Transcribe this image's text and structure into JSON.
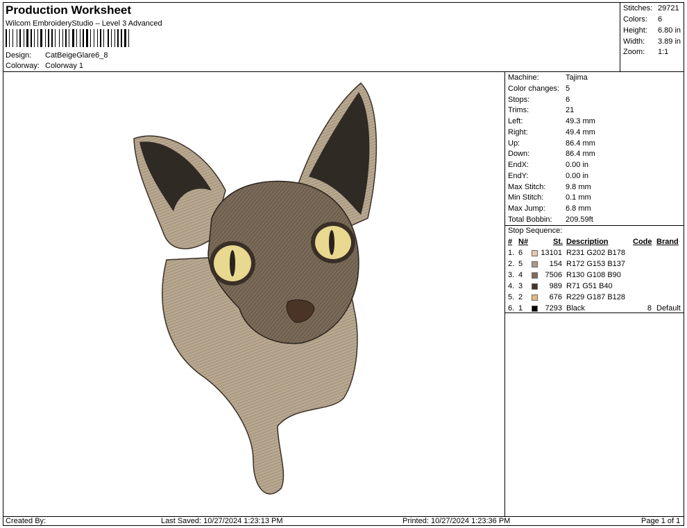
{
  "header": {
    "title": "Production Worksheet",
    "subtitle": "Wilcom EmbroideryStudio – Level 3 Advanced",
    "design_label": "Design:",
    "design_value": "CatBeigeGlare6_8",
    "colorway_label": "Colorway:",
    "colorway_value": "Colorway 1"
  },
  "stats": [
    {
      "k": "Stitches:",
      "v": "29721"
    },
    {
      "k": "Colors:",
      "v": "6"
    },
    {
      "k": "Height:",
      "v": "6.80 in"
    },
    {
      "k": "Width:",
      "v": "3.89 in"
    },
    {
      "k": "Zoom:",
      "v": "1:1"
    }
  ],
  "machine_info": [
    {
      "k": "Machine:",
      "v": "Tajima"
    },
    {
      "k": "Color changes:",
      "v": "5"
    },
    {
      "k": "Stops:",
      "v": "6"
    },
    {
      "k": "Trims:",
      "v": "21"
    },
    {
      "k": "Left:",
      "v": "49.3 mm"
    },
    {
      "k": "Right:",
      "v": "49.4 mm"
    },
    {
      "k": "Up:",
      "v": "86.4 mm"
    },
    {
      "k": "Down:",
      "v": "86.4 mm"
    },
    {
      "k": "EndX:",
      "v": "0.00 in"
    },
    {
      "k": "EndY:",
      "v": "0.00 in"
    },
    {
      "k": "Max Stitch:",
      "v": "9.8 mm"
    },
    {
      "k": "Min Stitch:",
      "v": "0.1 mm"
    },
    {
      "k": "Max Jump:",
      "v": "6.8 mm"
    },
    {
      "k": "Total Bobbin:",
      "v": "209.59ft"
    }
  ],
  "stop_sequence": {
    "title": "Stop Sequence:",
    "headers": {
      "num": "#",
      "n": "N#",
      "st": "St.",
      "desc": "Description",
      "code": "Code",
      "brand": "Brand"
    },
    "rows": [
      {
        "num": "1.",
        "n": "6",
        "color": "#E7CAB2",
        "st": "13101",
        "desc": "R231 G202 B178",
        "code": "",
        "brand": ""
      },
      {
        "num": "2.",
        "n": "5",
        "color": "#AC9989",
        "st": "154",
        "desc": "R172 G153 B137",
        "code": "",
        "brand": ""
      },
      {
        "num": "3.",
        "n": "4",
        "color": "#826C5A",
        "st": "7506",
        "desc": "R130 G108 B90",
        "code": "",
        "brand": ""
      },
      {
        "num": "4.",
        "n": "3",
        "color": "#473328",
        "st": "989",
        "desc": "R71 G51 B40",
        "code": "",
        "brand": ""
      },
      {
        "num": "5.",
        "n": "2",
        "color": "#E5BB80",
        "st": "676",
        "desc": "R229 G187 B128",
        "code": "",
        "brand": ""
      },
      {
        "num": "6.",
        "n": "1",
        "color": "#000000",
        "st": "7293",
        "desc": "Black",
        "code": "8",
        "brand": "Default"
      }
    ]
  },
  "footer": {
    "created_by": "Created By:",
    "last_saved": "Last Saved: 10/27/2024 1:23:13 PM",
    "printed": "Printed: 10/27/2024 1:23:36 PM",
    "page": "Page 1 of 1"
  }
}
